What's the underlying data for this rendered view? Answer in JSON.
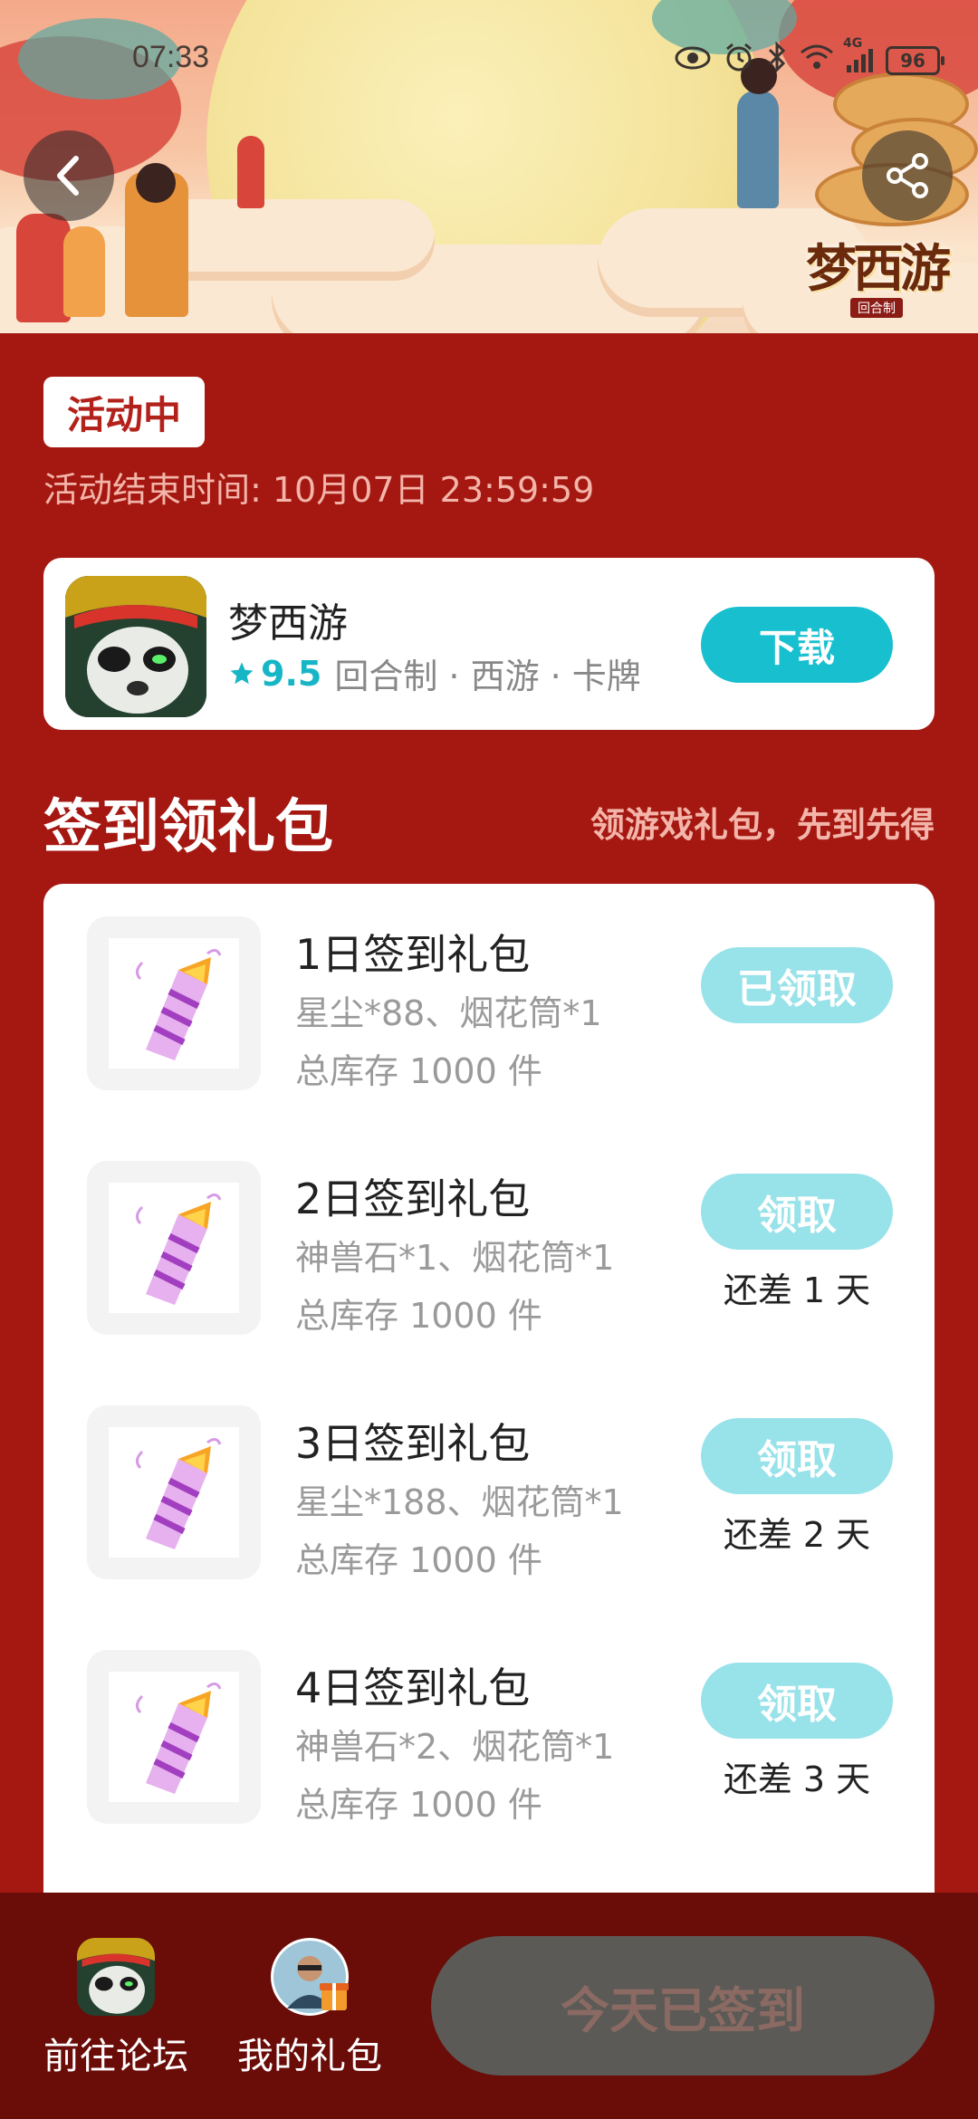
{
  "status_bar": {
    "time": "07:33",
    "battery": "96",
    "network": "4G"
  },
  "banner": {
    "logo_text": "梦西游",
    "logo_tag": "回合制"
  },
  "activity": {
    "status": "活动中",
    "end_time": "活动结束时间: 10月07日 23:59:59"
  },
  "game": {
    "name": "梦西游",
    "rating": "9.5",
    "tags": "回合制 · 西游 · 卡牌",
    "download_label": "下载"
  },
  "section": {
    "title": "签到领礼包",
    "subtitle": "领游戏礼包，先到先得"
  },
  "gifts": [
    {
      "title": "1日签到礼包",
      "desc": "星尘*88、烟花筒*1",
      "stock": "总库存 1000 件",
      "button": "已领取",
      "days_left": ""
    },
    {
      "title": "2日签到礼包",
      "desc": "神兽石*1、烟花筒*1",
      "stock": "总库存 1000 件",
      "button": "领取",
      "days_left": "还差 1 天"
    },
    {
      "title": "3日签到礼包",
      "desc": "星尘*188、烟花筒*1",
      "stock": "总库存 1000 件",
      "button": "领取",
      "days_left": "还差 2 天"
    },
    {
      "title": "4日签到礼包",
      "desc": "神兽石*2、烟花筒*1",
      "stock": "总库存 1000 件",
      "button": "领取",
      "days_left": "还差 3 天"
    }
  ],
  "bottom_bar": {
    "forum_label": "前往论坛",
    "my_gifts_label": "我的礼包",
    "signed_label": "今天已签到"
  },
  "colors": {
    "page_bg": "#A51812",
    "accent": "#17BFCF",
    "claim_disabled": "#98E2E9",
    "bottom_bar": "#6A0C08"
  }
}
